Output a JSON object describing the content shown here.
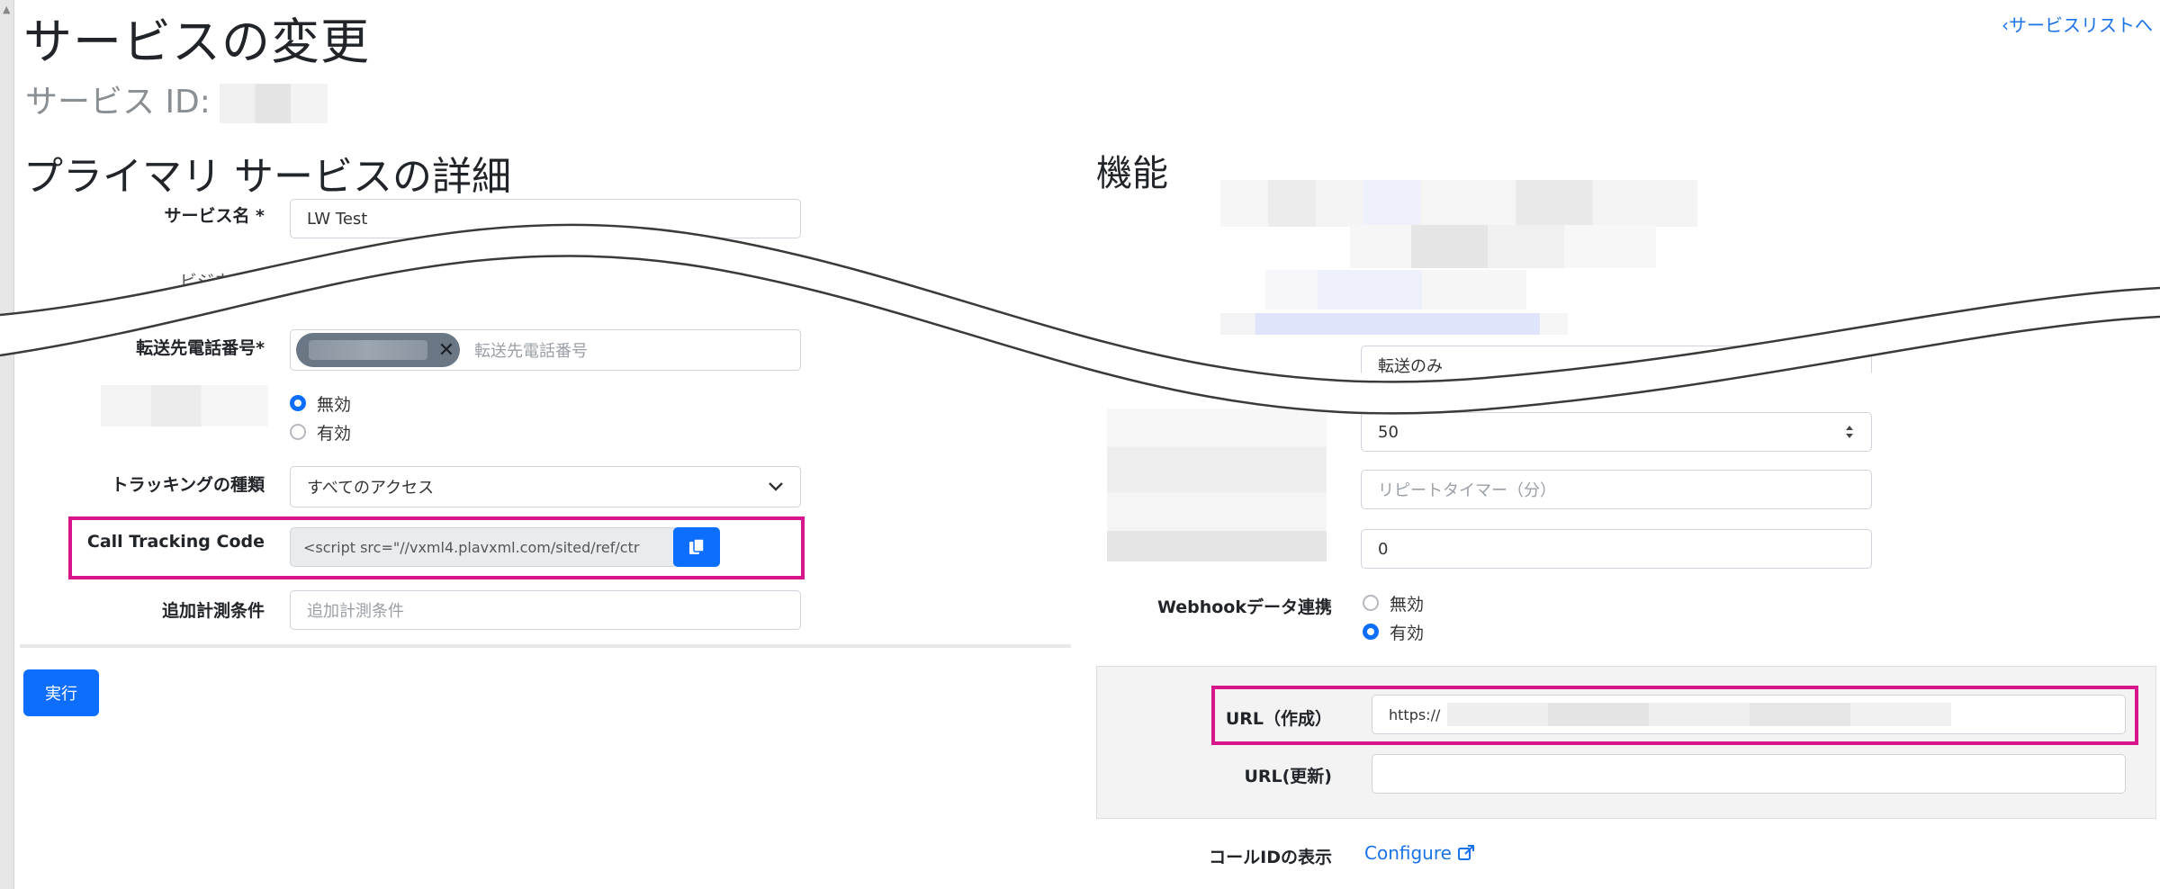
{
  "page_title": "サービスの変更",
  "service_id_label": "サービス ID:",
  "back_link": "‹サービスリストへ",
  "primary_section_title": "プライマリ サービスの詳細",
  "features_section_title": "機能",
  "fields": {
    "service_name": {
      "label": "サービス名 *",
      "value": "LW Test"
    },
    "business": {
      "label": "ビジネス..."
    },
    "forward_number": {
      "label": "転送先電話番号*",
      "placeholder": "転送先電話番号"
    },
    "status": {
      "options": [
        "無効",
        "有効"
      ],
      "selected": "無効"
    },
    "tracking_type": {
      "label": "トラッキングの種類",
      "value": "すべてのアクセス"
    },
    "call_tracking_code": {
      "label": "Call Tracking Code",
      "value": "<script src=\"//vxml4.plavxml.com/sited/ref/ctr"
    },
    "extra_condition": {
      "label": "追加計測条件",
      "placeholder": "追加計測条件"
    }
  },
  "submit_button": "実行",
  "right_fields": {
    "forward_mode": {
      "value": "転送のみ"
    },
    "number_value": "50",
    "repeat_timer_placeholder": "リピートタイマー（分）",
    "zero_value": "0",
    "webhook": {
      "label": "Webhookデータ連携",
      "options": [
        "無効",
        "有効"
      ],
      "selected": "有効"
    },
    "url_create": {
      "label": "URL（作成）",
      "value": "https://"
    },
    "url_update": {
      "label": "URL(更新)",
      "value": ""
    },
    "call_id_display": {
      "label": "コールIDの表示",
      "link": "Configure"
    }
  },
  "colors": {
    "accent": "#0d6efd",
    "highlight": "#d6168a",
    "link": "#1a73e8"
  }
}
